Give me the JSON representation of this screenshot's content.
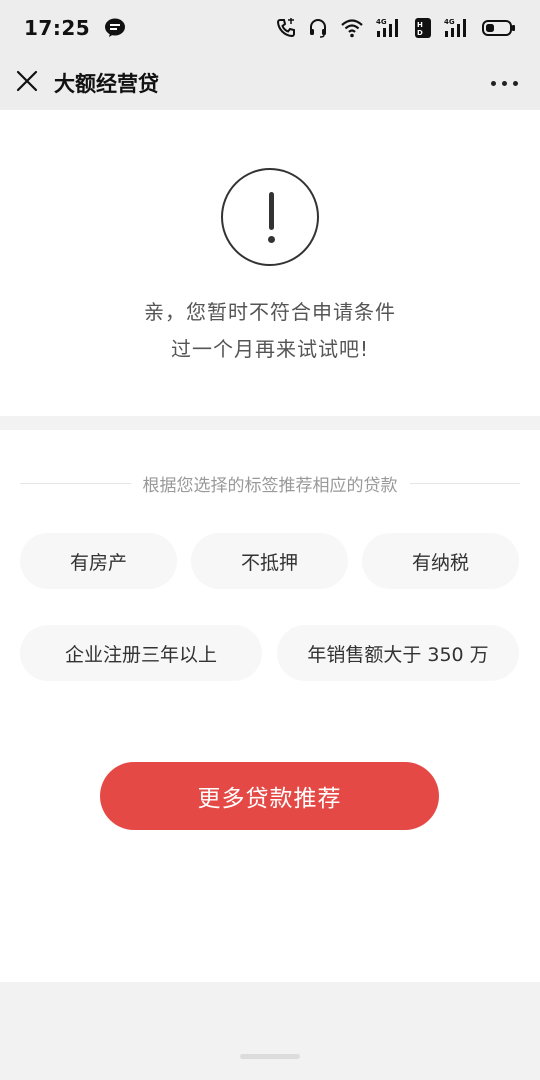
{
  "status_bar": {
    "time": "17:25",
    "icons": [
      "message-bubble-icon",
      "phone-icon",
      "headset-icon",
      "wifi-icon",
      "signal-4g-icon",
      "hd-icon",
      "signal-4g-icon",
      "battery-icon"
    ],
    "network_labels": [
      "4G",
      "HD",
      "4G"
    ]
  },
  "nav": {
    "title": "大额经营贷",
    "close_icon": "close-icon",
    "more_icon": "more-dots-icon"
  },
  "result": {
    "icon": "exclamation-circle-icon",
    "line1": "亲，您暂时不符合申请条件",
    "line2": "过一个月再来试试吧!"
  },
  "recommend": {
    "divider_text": "根据您选择的标签推荐相应的贷款",
    "tags": [
      "有房产",
      "不抵押",
      "有纳税",
      "企业注册三年以上",
      "年销售额大于 350 万"
    ],
    "button_label": "更多贷款推荐"
  },
  "colors": {
    "accent": "#e54945",
    "background": "#f2f2f2",
    "card": "#ffffff",
    "tag_bg": "#f7f7f7"
  }
}
